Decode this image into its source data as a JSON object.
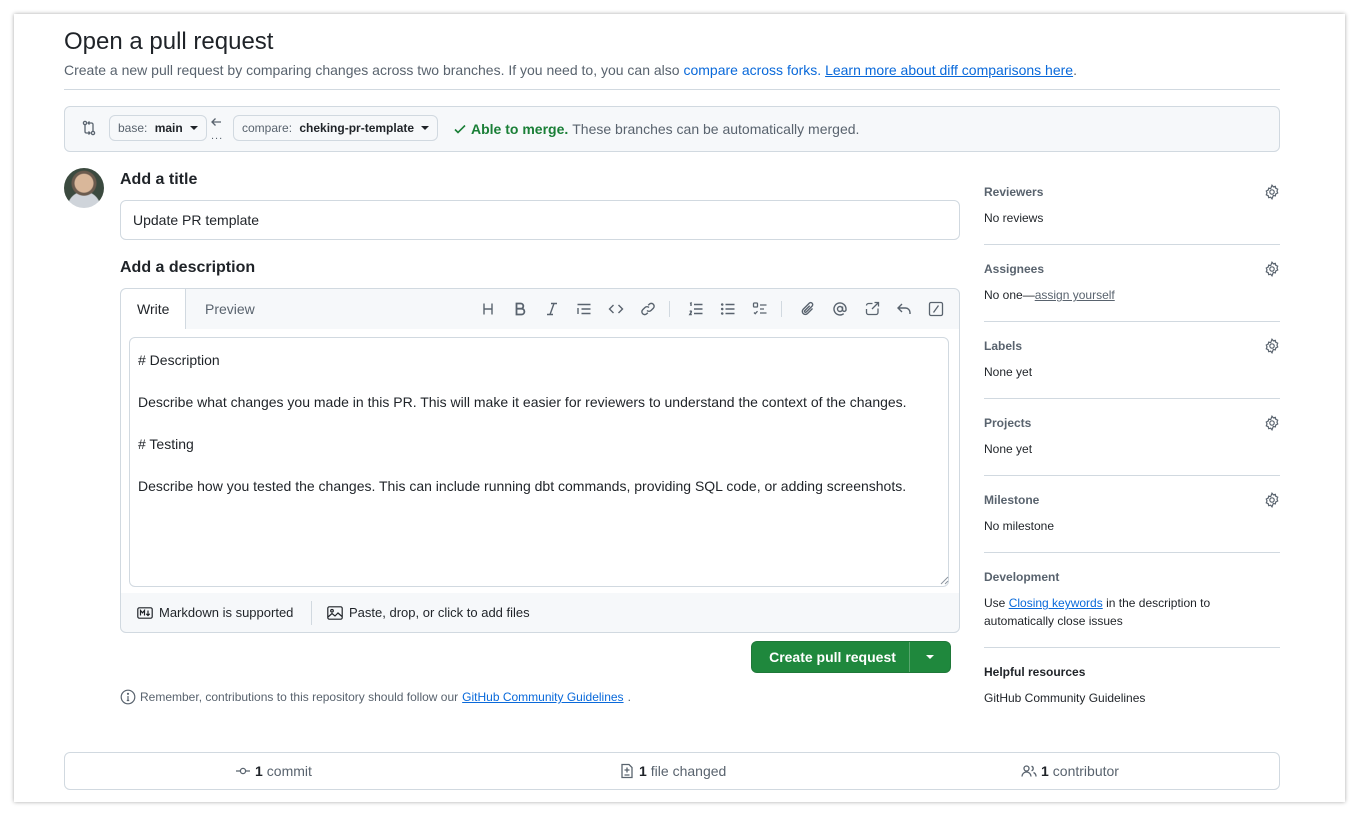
{
  "page": {
    "title": "Open a pull request",
    "subtitle_text": "Create a new pull request by comparing changes across two branches. If you need to, you can also",
    "compare_forks_link": "compare across forks.",
    "learn_more_link": "Learn more about diff comparisons here",
    "subtitle_end": "."
  },
  "range": {
    "base_label": "base:",
    "base_branch": "main",
    "compare_label": "compare:",
    "compare_branch": "cheking-pr-template",
    "dots": "...",
    "merge_ok": "Able to merge.",
    "merge_text": "These branches can be automatically merged.",
    "merge_color": "#1a7f37"
  },
  "form": {
    "title_label": "Add a title",
    "title_value": "Update PR template",
    "description_label": "Add a description",
    "tab_write": "Write",
    "tab_preview": "Preview",
    "toolbar_icons": [
      "heading-icon",
      "bold-icon",
      "italic-icon",
      "quote-icon",
      "code-icon",
      "link-icon",
      "numbered-list-icon",
      "unordered-list-icon",
      "task-list-icon",
      "attach-icon",
      "mention-icon",
      "cross-reference-icon",
      "reply-icon",
      "slash-commands-icon"
    ],
    "body": "# Description\n\nDescribe what changes you made in this PR. This will make it easier for reviewers to understand the context of the changes.\n\n# Testing\n\nDescribe how you tested the changes. This can include running dbt commands, providing SQL code, or adding screenshots.",
    "markdown_note": "Markdown is supported",
    "attach_note": "Paste, drop, or click to add files",
    "create_button": "Create pull request",
    "create_color": "#1f883d",
    "reminder_text": "Remember, contributions to this repository should follow our",
    "reminder_link": "GitHub Community Guidelines",
    "reminder_end": "."
  },
  "sidebar": {
    "reviewers": {
      "label": "Reviewers",
      "value": "No reviews"
    },
    "assignees": {
      "label": "Assignees",
      "value": "No one—",
      "link": "assign yourself"
    },
    "labels": {
      "label": "Labels",
      "value": "None yet"
    },
    "projects": {
      "label": "Projects",
      "value": "None yet"
    },
    "milestone": {
      "label": "Milestone",
      "value": "No milestone"
    },
    "development": {
      "label": "Development",
      "text_pre": "Use",
      "link": "Closing keywords",
      "text_post": "in the description to",
      "text_line2": "automatically close issues"
    },
    "helpful": {
      "label": "Helpful resources",
      "link": "GitHub Community Guidelines"
    }
  },
  "stats": {
    "commits_count": "1",
    "commits_label": "commit",
    "files_count": "1",
    "files_label": "file changed",
    "contributors_count": "1",
    "contributors_label": "contributor"
  },
  "colors": {
    "link": "#0969da",
    "muted": "#59636e",
    "border": "#d1d9e0"
  }
}
